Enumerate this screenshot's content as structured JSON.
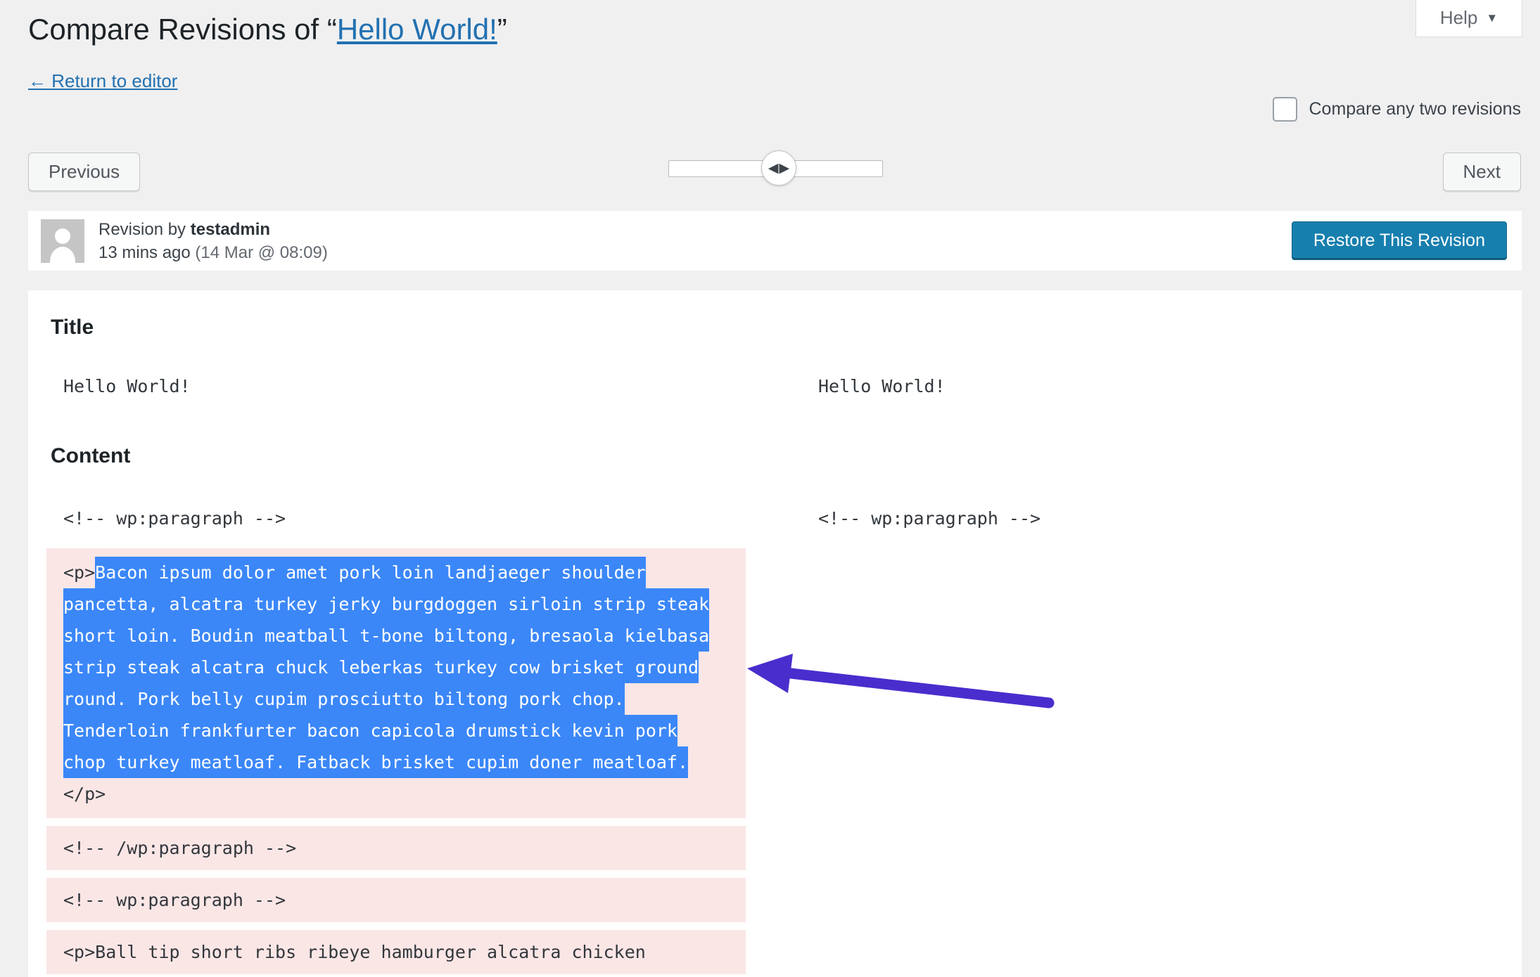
{
  "header": {
    "help_label": "Help",
    "title_prefix": "Compare Revisions of “",
    "title_link": "Hello World!",
    "title_suffix": "”",
    "return_link": "← Return to editor",
    "compare_label": "Compare any two revisions"
  },
  "nav": {
    "previous_label": "Previous",
    "next_label": "Next"
  },
  "revision": {
    "byline_prefix": "Revision by ",
    "author": "testadmin",
    "time_ago": "13 mins ago",
    "timestamp": "(14 Mar @ 08:09)",
    "restore_label": "Restore This Revision"
  },
  "diff": {
    "title_heading": "Title",
    "title_left": "Hello World!",
    "title_right": "Hello World!",
    "content_heading": "Content",
    "content": {
      "open_comment_left": "<!-- wp:paragraph -->",
      "open_comment_right": "<!-- wp:paragraph -->",
      "p_open": "<p>",
      "selected_text": "Bacon ipsum dolor amet pork loin landjaeger shoulder pancetta, alcatra turkey jerky burgdoggen sirloin strip steak short loin. Boudin meatball t-bone biltong, bresaola kielbasa strip steak alcatra chuck leberkas turkey cow brisket ground round. Pork belly cupim prosciutto biltong pork chop. Tenderloin frankfurter bacon capicola drumstick kevin pork chop turkey meatloaf. Fatback brisket cupim doner meatloaf.",
      "p_close": "</p>",
      "removed_lines": [
        "<!-- /wp:paragraph -->",
        "<!-- wp:paragraph -->",
        "<p>Ball tip short ribs ribeye hamburger alcatra chicken"
      ]
    }
  },
  "colors": {
    "page_background": "#f0f0f1",
    "link_blue": "#2271b1",
    "restore_button_blue": "#177fae",
    "selection_blue": "#3b87f8",
    "removed_line_pink": "#fbe6e6",
    "arrow_purple": "#4a2dcd"
  }
}
